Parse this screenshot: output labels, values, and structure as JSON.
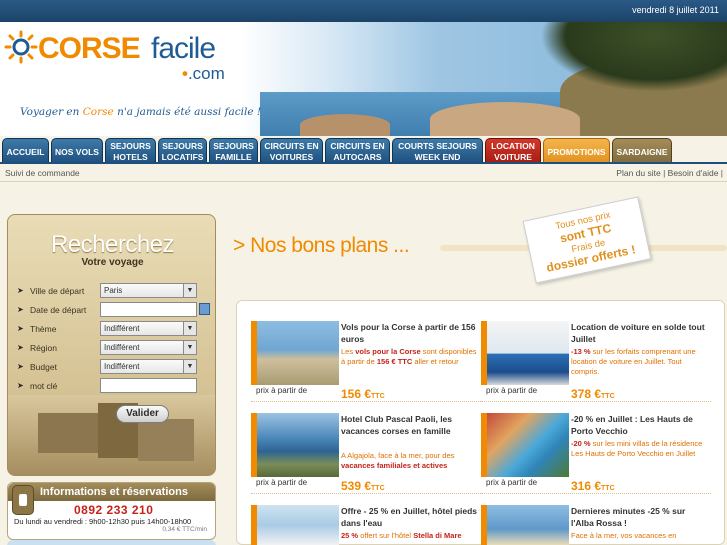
{
  "topbar": {
    "date": "vendredi 8 juillet 2011"
  },
  "logo": {
    "brand_orange": "CORSE",
    "brand_blue": "facile",
    "dotcom": ".com",
    "dot": "•"
  },
  "tagline": {
    "part1": "Voyager en ",
    "part2": "Corse",
    "part3": " n'a jamais été aussi facile !"
  },
  "nav": {
    "tabs": [
      {
        "l1": "ACCUEIL",
        "l2": ""
      },
      {
        "l1": "NOS VOLS",
        "l2": ""
      },
      {
        "l1": "SEJOURS",
        "l2": "HOTELS"
      },
      {
        "l1": "SEJOURS",
        "l2": "LOCATIFS"
      },
      {
        "l1": "SEJOURS",
        "l2": "FAMILLE"
      },
      {
        "l1": "CIRCUITS EN",
        "l2": "VOITURES"
      },
      {
        "l1": "CIRCUITS EN",
        "l2": "AUTOCARS"
      },
      {
        "l1": "COURTS SEJOURS",
        "l2": "WEEK END"
      },
      {
        "l1": "LOCATION",
        "l2": "VOITURE"
      },
      {
        "l1": "PROMOTIONS",
        "l2": ""
      },
      {
        "l1": "SARDAIGNE",
        "l2": ""
      }
    ]
  },
  "subnav": {
    "left": "Suivi de commande",
    "right": "Plan du site | Besoin d'aide |"
  },
  "search": {
    "title": "Recherchez",
    "subtitle": "Votre voyage",
    "arrow": "➤",
    "fields": [
      {
        "label": "Ville de départ",
        "value": "Paris"
      },
      {
        "label": "Date de départ",
        "value": ""
      },
      {
        "label": "Thème",
        "value": "Indifférent"
      },
      {
        "label": "Région",
        "value": "Indifférent"
      },
      {
        "label": "Budget",
        "value": "Indifférent"
      },
      {
        "label": "mot clé",
        "value": ""
      }
    ],
    "chevron": "▼",
    "submit": "Valider"
  },
  "info": {
    "title": "Informations et réservations",
    "phone": "0892 233 210",
    "hours": "Du lundi au vendredi : 9h00-12h30 puis 14h00-18h00",
    "price": "0,34 € TTC/min"
  },
  "bons_plans": {
    "title": "> Nos bons plans ...",
    "promo_l1": "Tous nos prix",
    "promo_l2": "sont TTC",
    "promo_l3": "Frais de",
    "promo_l4": "dossier offerts !"
  },
  "offers": [
    {
      "title": "Vols pour la Corse à partir de 156 euros",
      "desc_a": "Les ",
      "desc_b": "vols pour la Corse",
      "desc_c": " sont disponibles à partir de ",
      "desc_d": "156 € TTC",
      "desc_e": " aller et retour",
      "from": "prix à partir de",
      "price": "156 €",
      "ttc": "TTC"
    },
    {
      "title": "Location de voiture en solde tout Juillet",
      "desc_a": "",
      "desc_b": "-13 %",
      "desc_c": " sur les forfaits comprenant une location de voiture en Juillet. Tout compris.",
      "desc_d": "",
      "desc_e": "",
      "from": "prix à partir de",
      "price": "378 €",
      "ttc": "TTC"
    },
    {
      "title": "Hotel Club Pascal Paoli, les vacances corses en famille",
      "desc_a": "A Algajola, face à la mer, pour des ",
      "desc_b": "vacances familiales et actives",
      "desc_c": "",
      "desc_d": "",
      "desc_e": "",
      "from": "prix à partir de",
      "price": "539 €",
      "ttc": "TTC"
    },
    {
      "title": "-20 % en Juillet : Les Hauts de Porto Vecchio",
      "desc_a": "",
      "desc_b": "-20 %",
      "desc_c": " sur les mini villas de la résidence Les Hauts de Porto Vecchio en Juillet",
      "desc_d": "",
      "desc_e": "",
      "from": "prix à partir de",
      "price": "316 €",
      "ttc": "TTC"
    },
    {
      "title": "Offre - 25 % en Juillet, hôtel pieds dans l'eau",
      "desc_a": "",
      "desc_b": "25 %",
      "desc_c": " offert sur l'hôtel ",
      "desc_d": "Stella di Mare",
      "desc_e": "",
      "from": "",
      "price": "",
      "ttc": ""
    },
    {
      "title": "Dernieres minutes -25 % sur l'Alba Rossa !",
      "desc_a": "Face à la mer, vos vacances en",
      "desc_b": "",
      "desc_c": "",
      "desc_d": "",
      "desc_e": "",
      "from": "",
      "price": "",
      "ttc": ""
    }
  ],
  "colors": {
    "brand_orange": "#f08a00",
    "brand_blue": "#1f5b94",
    "nav_blue": "#1d4f7d",
    "nav_red": "#a51c12",
    "nav_orange": "#e0901d",
    "nav_brown": "#7e6a3d"
  }
}
